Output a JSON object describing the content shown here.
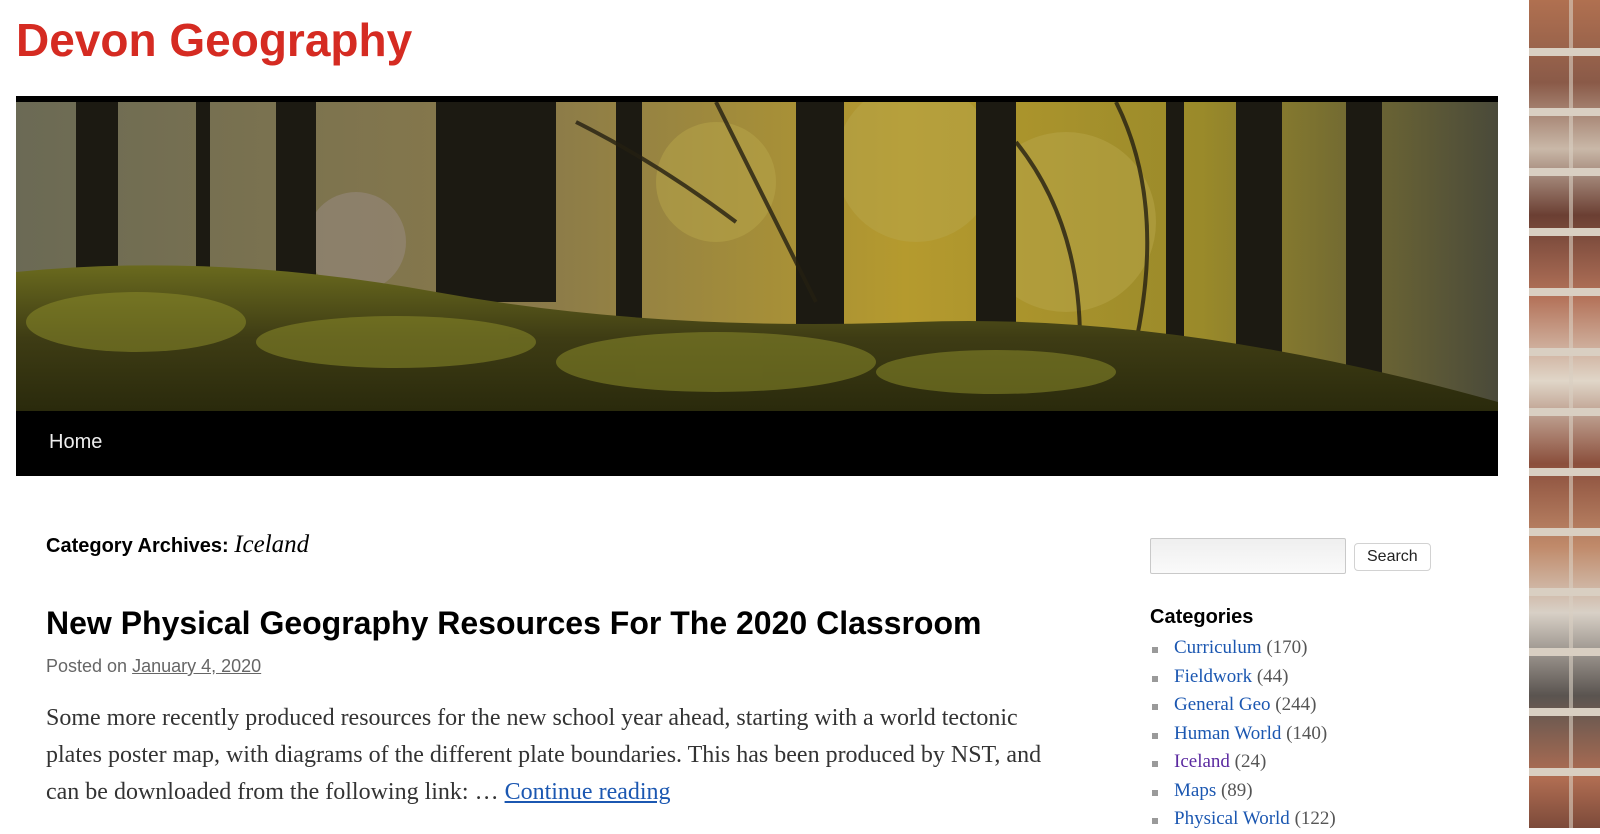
{
  "site": {
    "title": "Devon Geography",
    "title_color": "#d52b22"
  },
  "nav": {
    "items": [
      {
        "label": "Home"
      }
    ]
  },
  "archive": {
    "prefix": "Category Archives:",
    "category": "Iceland"
  },
  "post": {
    "title": "New Physical Geography Resources For The 2020 Classroom",
    "posted_on_label": "Posted on",
    "date": "January 4, 2020",
    "summary": "Some more recently produced resources for the new school year ahead, starting with a world tectonic plates poster map, with diagrams of the different plate boundaries. This has been produced by NST, and can be downloaded from the following link: … ",
    "continue_label": "Continue reading"
  },
  "sidebar": {
    "search": {
      "value": "",
      "placeholder": "",
      "button_label": "Search"
    },
    "categories_title": "Categories",
    "categories": [
      {
        "name": "Curriculum",
        "count": "(170)"
      },
      {
        "name": "Fieldwork",
        "count": "(44)"
      },
      {
        "name": "General Geo",
        "count": "(244)"
      },
      {
        "name": "Human World",
        "count": "(140)"
      },
      {
        "name": "Iceland",
        "count": "(24)"
      },
      {
        "name": "Maps",
        "count": "(89)"
      },
      {
        "name": "Physical World",
        "count": "(122)"
      }
    ]
  },
  "colors": {
    "link": "#1b57b1",
    "visited_link": "#5b2aa0",
    "nav_background": "#000000"
  }
}
